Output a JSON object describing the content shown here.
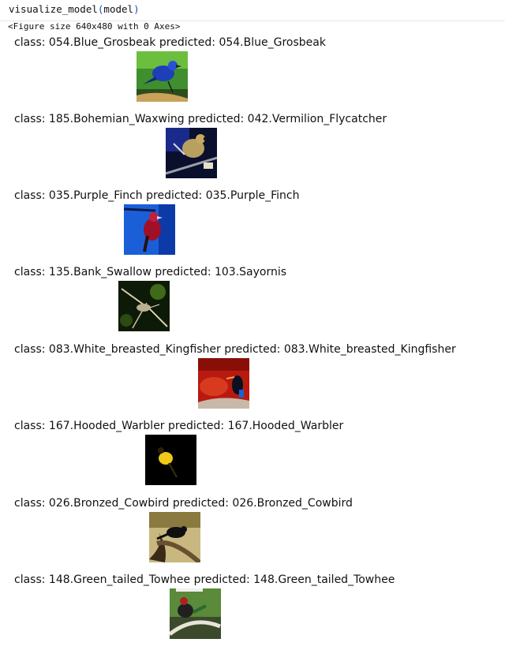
{
  "cell": {
    "fn": "visualize_model",
    "open": "(",
    "arg": "model",
    "close": ")"
  },
  "figure_text": "<Figure size 640x480 with 0 Axes>",
  "results": [
    {
      "label": "class: 054.Blue_Grosbeak predicted: 054.Blue_Grosbeak",
      "icon": "blue-grosbeak-photo"
    },
    {
      "label": "class: 185.Bohemian_Waxwing predicted: 042.Vermilion_Flycatcher",
      "icon": "bohemian-waxwing-photo"
    },
    {
      "label": "class: 035.Purple_Finch predicted: 035.Purple_Finch",
      "icon": "purple-finch-photo"
    },
    {
      "label": "class: 135.Bank_Swallow predicted: 103.Sayornis",
      "icon": "bank-swallow-photo"
    },
    {
      "label": "class: 083.White_breasted_Kingfisher predicted: 083.White_breasted_Kingfisher",
      "icon": "kingfisher-photo"
    },
    {
      "label": "class: 167.Hooded_Warbler predicted: 167.Hooded_Warbler",
      "icon": "hooded-warbler-photo"
    },
    {
      "label": "class: 026.Bronzed_Cowbird predicted: 026.Bronzed_Cowbird",
      "icon": "bronzed-cowbird-photo"
    },
    {
      "label": "class: 148.Green_tailed_Towhee predicted: 148.Green_tailed_Towhee",
      "icon": "green-tailed-towhee-photo"
    }
  ]
}
